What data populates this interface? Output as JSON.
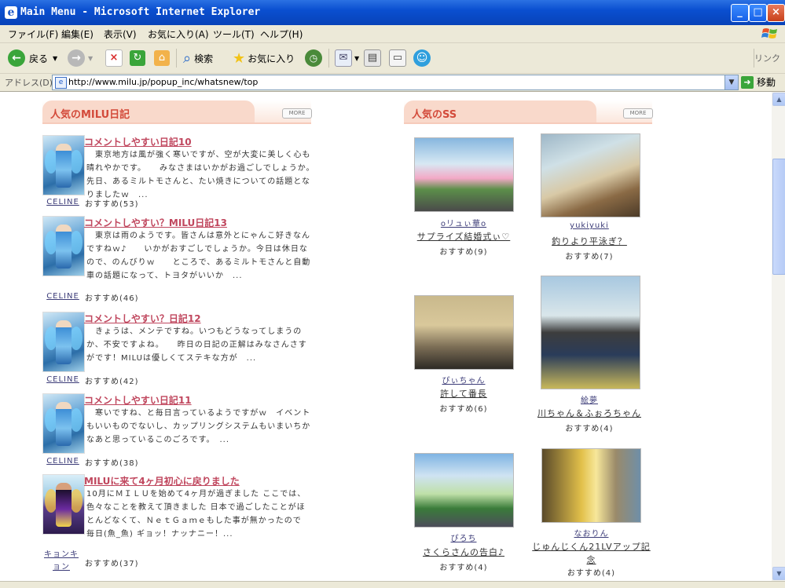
{
  "window": {
    "title": "Main Menu - Microsoft Internet Explorer",
    "controls": [
      "_",
      "□",
      "×"
    ]
  },
  "menu": [
    "ファイル(F)",
    "編集(E)",
    "表示(V)",
    "お気に入り(A)",
    "ツール(T)",
    "ヘルプ(H)"
  ],
  "toolbar": {
    "back_label": "戻る",
    "search_label": "検索",
    "favorites_label": "お気に入り",
    "links_label": "リンク"
  },
  "address": {
    "label": "アドレス(D)",
    "url": "http://www.milu.jp/popup_inc/whatsnew/top",
    "go_label": "移動"
  },
  "diary": {
    "header": "人気のMILU日記",
    "more": "MORE",
    "entries": [
      {
        "title": "コメントしやすい日記10",
        "body": "　東京地方は風が強く寒いですが、空が大変に美しく心も晴れやかです。　　みなさまはいかがお過ごしでしょうか。　　先日、あるミルトモさんと、たい焼きについての話題となりましたｗ　...",
        "author": "CELINE",
        "rec": "おすすめ(53)"
      },
      {
        "title": "コメントしやすい？MILU日記13",
        "body": "　東京は雨のようです。皆さんは意外とにゃんこ好きなんですねｗ♪　　いかがおすごしでしょうか。今日は休日なので、のんびりｗ　　ところで、あるミルトモさんと自動車の話題になって、トヨタがいいか　...",
        "author": "CELINE",
        "rec": "おすすめ(46)"
      },
      {
        "title": "コメントしやすい？日記12",
        "body": "　きょうは、メンテですね。いつもどうなってしまうのか、不安ですよね。　　昨日の日記の正解はみなさんさすがです！MILUは優しくてステキな方が　...",
        "author": "CELINE",
        "rec": "おすすめ(42)"
      },
      {
        "title": "コメントしやすい日記11",
        "body": "　寒いですね、と毎日言っているようですがｗ　イベントもいいものでないし、カップリングシステムもいまいちかなあと思っているこのごろです。　...",
        "author": "CELINE",
        "rec": "おすすめ(38)"
      },
      {
        "title": "MILUに来て4ヶ月初心に戻りました",
        "body": "10月にＭＩＬＵを始めて4ヶ月が過ぎました ここでは、色々なことを教えて頂きました 日本で過ごしたことがほとんどなくて、ＮｅｔＧａｍｅもした事が無かったので 毎日(魚_魚) ギョッ！ナッナニー！...",
        "author": "キョンキョン",
        "rec": "おすすめ(37)"
      }
    ]
  },
  "ss": {
    "header": "人気のSS",
    "more": "MORE",
    "items": [
      {
        "user": "oリュぃ華o",
        "title": "サプライズ結婚式ぃ♡",
        "rec": "おすすめ(9)"
      },
      {
        "user": "yukiyuki",
        "title": "釣りより平泳ぎ？",
        "rec": "おすすめ(7)"
      },
      {
        "user": "ぴぃちゃん",
        "title": "許して番長",
        "rec": "おすすめ(6)"
      },
      {
        "user": "絵夢",
        "title": "川ちゃん＆ふぉろちゃん",
        "rec": "おすすめ(4)"
      },
      {
        "user": "ぴろち",
        "title": "さくらさんの告白♪",
        "rec": "おすすめ(4)"
      },
      {
        "user": "なおりん",
        "title": "じゅんじくん21LVアップ記念",
        "rec": "おすすめ(4)"
      }
    ]
  }
}
